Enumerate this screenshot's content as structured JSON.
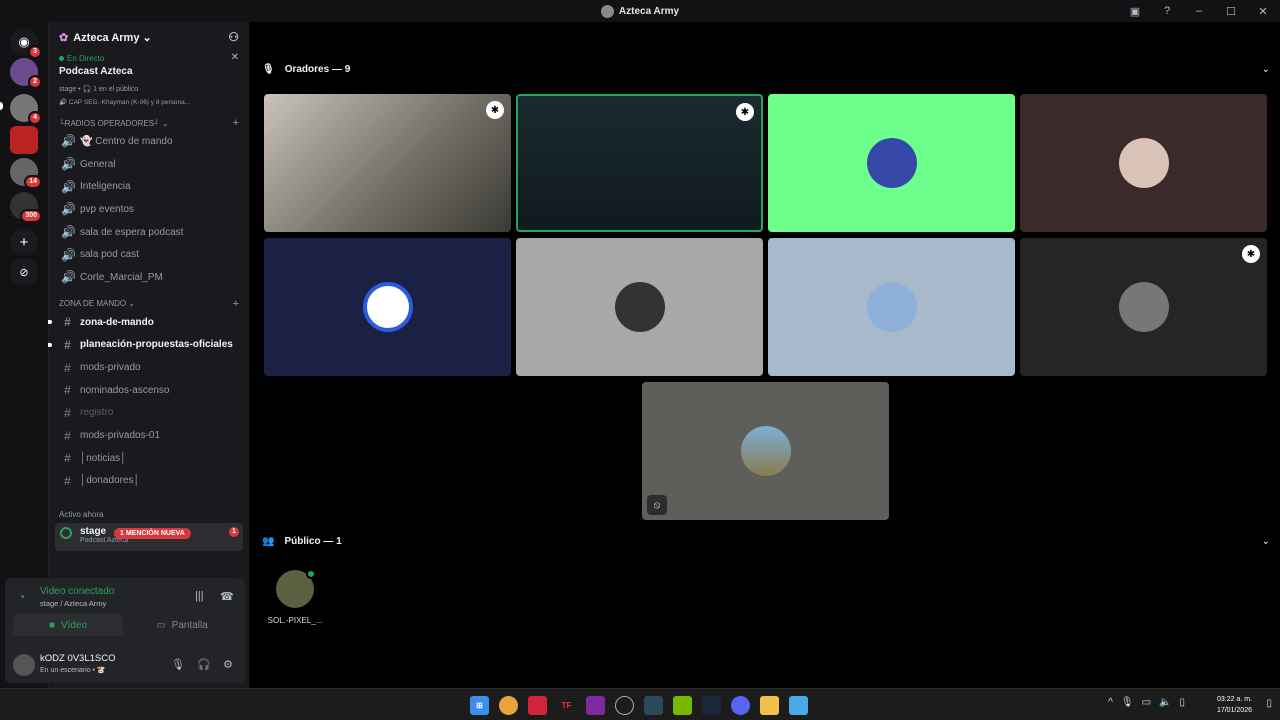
{
  "window": {
    "title": "Azteca Army"
  },
  "guilds": {
    "badges": [
      "3",
      "2",
      "4",
      "14",
      "300"
    ]
  },
  "server": {
    "name": "Azteca Army ⌄"
  },
  "live": {
    "label": "En Directo",
    "name": "Podcast Azteca",
    "meta": "stage • 🎧 1 en el público",
    "speakers": "🔊 CAP SEG.-Khayman (K-06) y 8 persona..."
  },
  "categories": {
    "radios": "└RADIOS OPERADORES┘ ⌄",
    "zona": "ZONA DE MANDO ⌄"
  },
  "voice_channels": [
    "👻 Centro de mando",
    "General",
    "Inteligencia",
    "pvp eventos",
    "sala de espera podcast",
    "sala pod cast",
    "Corte_Marcial_PM"
  ],
  "text_channels": [
    "zona-de-mando",
    "planeación-propuestas-oficiales",
    "mods-privado",
    "nominados-ascenso",
    "registro",
    "mods-privados-01",
    "│noticias│",
    "│donadores│"
  ],
  "active_now": {
    "label": "Activo ahora",
    "stage_name": "stage",
    "stage_sub": "Podcast Azteca",
    "mention": "1 MENCIÓN NUEVA",
    "mention_count": "1"
  },
  "voice_panel": {
    "title": "Video conectado",
    "sub": "stage / Azteca Army",
    "video_label": "Vídeo",
    "screen_label": "Pantalla"
  },
  "user": {
    "name": "kODZ 0V3L1SCO",
    "status": "En un escenario • 🐮"
  },
  "speakers_section": {
    "label": "Oradores — 9"
  },
  "audience_section": {
    "label": "Público — 1"
  },
  "audience": [
    {
      "name": "SOL.-PIXEL_..."
    }
  ],
  "colors": {
    "accent_green": "#23a55a",
    "mention_red": "#da373c",
    "tile_green": "#6cff8c"
  },
  "taskbar": {
    "time": "03:22 a. m.",
    "date": "17/01/2026"
  }
}
